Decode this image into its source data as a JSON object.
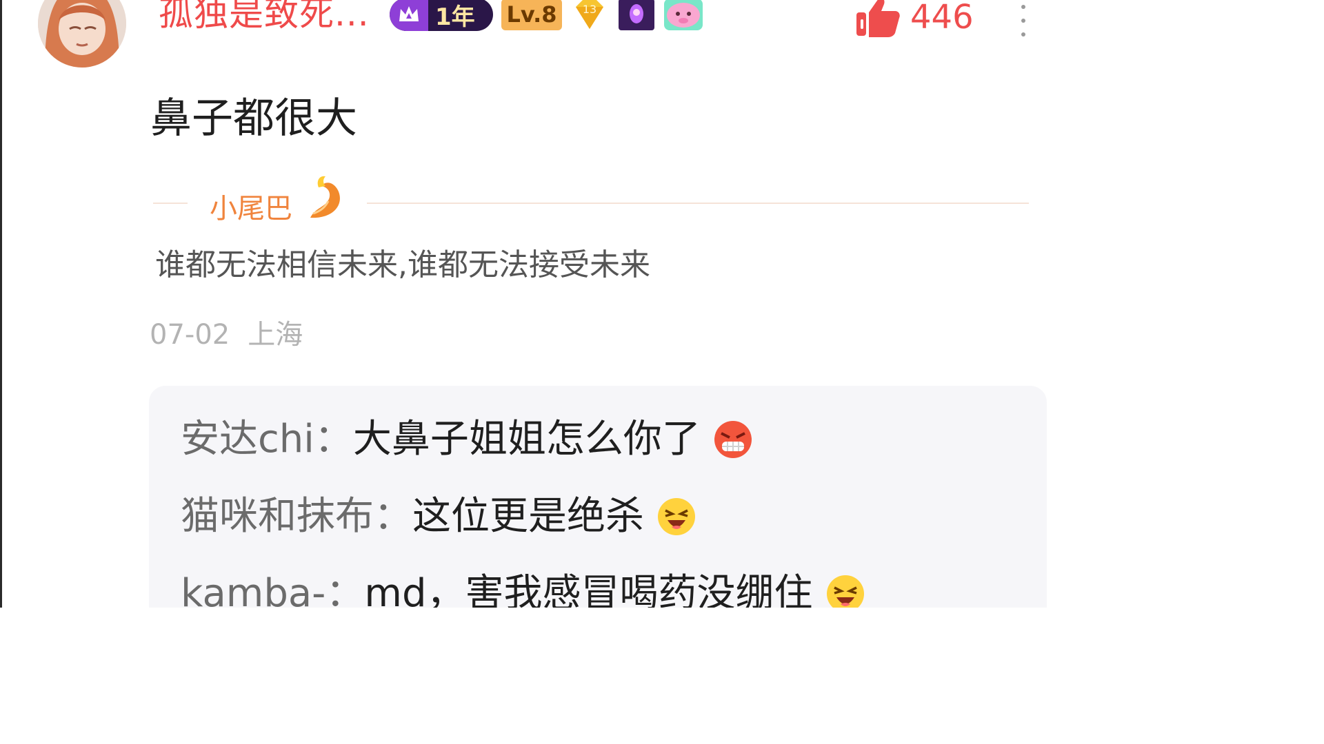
{
  "header": {
    "username": "孤独是致死...",
    "badges": {
      "fan_label": "1年",
      "level_label": "Lv.8",
      "diamond_number": "13"
    },
    "like_count": "446"
  },
  "comment": {
    "text": "鼻子都很大",
    "tail_label": "小尾巴",
    "signature": "谁都无法相信未来,谁都无法接受未来",
    "date": "07-02",
    "location": "上海"
  },
  "replies": [
    {
      "name": "安达chi：",
      "text": "大鼻子姐姐怎么你了",
      "emoji": "angry-emoji"
    },
    {
      "name": "猫咪和抹布：",
      "text": "这位更是绝杀",
      "emoji": "laughing-emoji"
    },
    {
      "name": "kamba-：",
      "text": "md，害我感冒喝药没绷住",
      "emoji": "laughing-emoji"
    }
  ],
  "colors": {
    "username": "#ef4a4a",
    "like": "#ee4d4d",
    "tail": "#f0843d",
    "reply_bg": "#f6f6f9"
  }
}
